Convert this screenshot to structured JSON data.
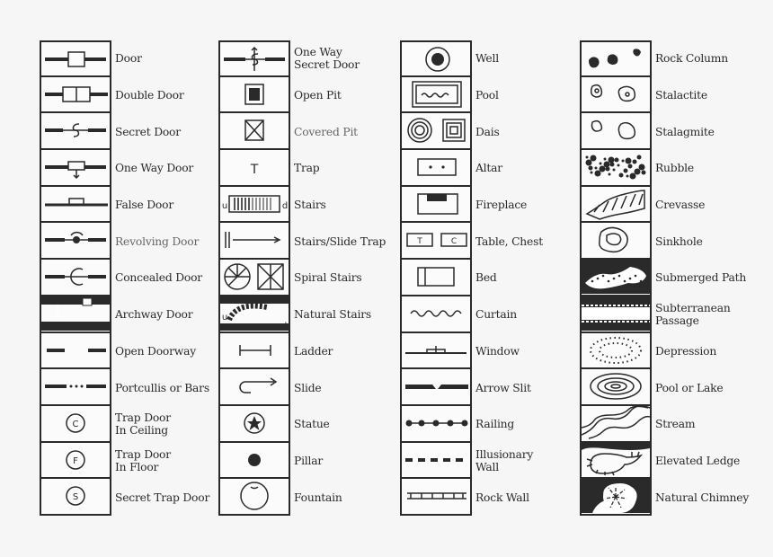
{
  "colors": {
    "ink": "#2a2a2a",
    "background": "#f6f6f6"
  },
  "columns": [
    {
      "items": [
        {
          "label": "Door",
          "icon": "door"
        },
        {
          "label": "Double Door",
          "icon": "double-door"
        },
        {
          "label": "Secret Door",
          "icon": "secret-door"
        },
        {
          "label": "One Way Door",
          "icon": "one-way-door"
        },
        {
          "label": "False Door",
          "icon": "false-door"
        },
        {
          "label": "Revolving Door",
          "icon": "revolving-door",
          "faint": true
        },
        {
          "label": "Concealed Door",
          "icon": "concealed-door"
        },
        {
          "label": "Archway Door",
          "icon": "archway-door"
        },
        {
          "label": "Open Doorway",
          "icon": "open-doorway"
        },
        {
          "label": "Portcullis or Bars",
          "icon": "portcullis"
        },
        {
          "label": "Trap Door\nIn Ceiling",
          "icon": "trap-door-ceiling",
          "glyph": "C"
        },
        {
          "label": "Trap Door\nIn Floor",
          "icon": "trap-door-floor",
          "glyph": "F"
        },
        {
          "label": "Secret Trap Door",
          "icon": "secret-trap-door",
          "glyph": "S"
        }
      ]
    },
    {
      "items": [
        {
          "label": "One Way\nSecret Door",
          "icon": "one-way-secret-door"
        },
        {
          "label": "Open Pit",
          "icon": "open-pit"
        },
        {
          "label": "Covered Pit",
          "icon": "covered-pit",
          "faint": true
        },
        {
          "label": "Trap",
          "icon": "trap",
          "glyph": "T"
        },
        {
          "label": "Stairs",
          "icon": "stairs",
          "glyph": "u d"
        },
        {
          "label": "Stairs/Slide Trap",
          "icon": "stairs-slide-trap"
        },
        {
          "label": "Spiral Stairs",
          "icon": "spiral-stairs"
        },
        {
          "label": "Natural Stairs",
          "icon": "natural-stairs",
          "glyph": "u d"
        },
        {
          "label": "Ladder",
          "icon": "ladder"
        },
        {
          "label": "Slide",
          "icon": "slide"
        },
        {
          "label": "Statue",
          "icon": "statue"
        },
        {
          "label": "Pillar",
          "icon": "pillar"
        },
        {
          "label": "Fountain",
          "icon": "fountain"
        }
      ]
    },
    {
      "items": [
        {
          "label": "Well",
          "icon": "well"
        },
        {
          "label": "Pool",
          "icon": "pool"
        },
        {
          "label": "Dais",
          "icon": "dais"
        },
        {
          "label": "Altar",
          "icon": "altar"
        },
        {
          "label": "Fireplace",
          "icon": "fireplace"
        },
        {
          "label": "Table, Chest",
          "icon": "table-chest",
          "glyph": "T C"
        },
        {
          "label": "Bed",
          "icon": "bed"
        },
        {
          "label": "Curtain",
          "icon": "curtain"
        },
        {
          "label": "Window",
          "icon": "window"
        },
        {
          "label": "Arrow Slit",
          "icon": "arrow-slit"
        },
        {
          "label": "Railing",
          "icon": "railing"
        },
        {
          "label": "Illusionary\nWall",
          "icon": "illusionary-wall"
        },
        {
          "label": "Rock Wall",
          "icon": "rock-wall"
        }
      ]
    },
    {
      "items": [
        {
          "label": "Rock Column",
          "icon": "rock-column"
        },
        {
          "label": "Stalactite",
          "icon": "stalactite"
        },
        {
          "label": "Stalagmite",
          "icon": "stalagmite"
        },
        {
          "label": "Rubble",
          "icon": "rubble"
        },
        {
          "label": "Crevasse",
          "icon": "crevasse"
        },
        {
          "label": "Sinkhole",
          "icon": "sinkhole"
        },
        {
          "label": "Submerged Path",
          "icon": "submerged-path"
        },
        {
          "label": "Subterranean\nPassage",
          "icon": "subterranean-passage"
        },
        {
          "label": "Depression",
          "icon": "depression"
        },
        {
          "label": "Pool or Lake",
          "icon": "pool-or-lake"
        },
        {
          "label": "Stream",
          "icon": "stream"
        },
        {
          "label": "Elevated Ledge",
          "icon": "elevated-ledge"
        },
        {
          "label": "Natural Chimney",
          "icon": "natural-chimney"
        }
      ]
    }
  ]
}
